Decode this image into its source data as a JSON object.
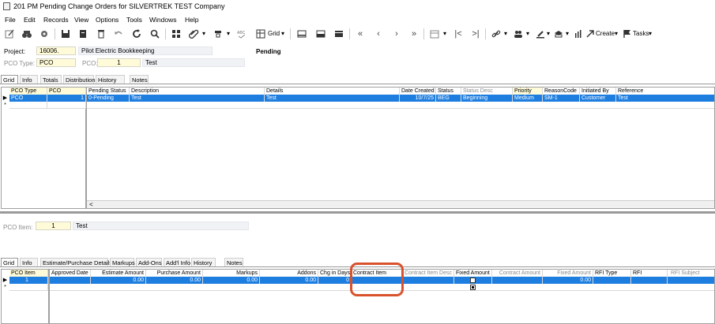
{
  "window": {
    "title": "201 PM Pending Change Orders for SILVERTREK TEST Company"
  },
  "menu": [
    "File",
    "Edit",
    "Records",
    "View",
    "Options",
    "Tools",
    "Windows",
    "Help"
  ],
  "toolbar": {
    "grid_label": "Grid",
    "create_label": "Create",
    "tasks_label": "Tasks",
    "icons": [
      "edit-icon",
      "binoculars-icon",
      "gear-icon",
      "save-icon",
      "new-doc-icon",
      "delete-icon",
      "undo-icon",
      "refresh-icon",
      "search-icon",
      "grid-icon",
      "attach-icon",
      "filter-icon",
      "spell-icon",
      "layout-icon",
      "first-icon",
      "prev-icon",
      "next-icon",
      "last-icon",
      "link-icon",
      "team-icon",
      "stamp-icon",
      "print-icon",
      "launch-icon",
      "flag-icon"
    ]
  },
  "header": {
    "project_label": "Project:",
    "project_value": "16006.",
    "project_desc": "Pilot Electric Bookkeeping",
    "status": "Pending",
    "pco_type_label": "PCO Type:",
    "pco_type_value": "PCO",
    "pco_label": "PCO:",
    "pco_value": "1",
    "pco_desc": "Test"
  },
  "top_tabs": [
    "Grid",
    "Info",
    "Totals",
    "Distribution",
    "History",
    "Notes"
  ],
  "top_grid": {
    "left_columns": [
      "PCO Type",
      "PCO"
    ],
    "left_row": [
      "PCO",
      "1"
    ],
    "columns": [
      "Pending Status",
      "Description",
      "Details",
      "Date Created",
      "Status",
      "Status Desc",
      "Priority",
      "ReasonCode",
      "Initiated By",
      "Reference"
    ],
    "row": [
      "0-Pending",
      "Test",
      "Test",
      "10/7/25",
      "BEG",
      "Beginning",
      "Medium",
      "SM-1",
      "Customer",
      "Test"
    ],
    "new_row_marker": "*",
    "scroll_left": "<"
  },
  "item_header": {
    "pco_item_label": "PCO Item:",
    "pco_item_value": "1",
    "pco_item_desc": "Test"
  },
  "bottom_tabs": [
    "Grid",
    "Info",
    "Estimate/Purchase Details",
    "Markups",
    "Add-Ons",
    "Add'l Info",
    "History",
    "Notes"
  ],
  "bottom_grid": {
    "left_columns": [
      "PCO Item"
    ],
    "left_row": [
      "1"
    ],
    "columns": [
      "Approved Date",
      "Estimate Amount",
      "Purchase Amount",
      "Markups",
      "Addons",
      "Chg in Days",
      "Contract Item",
      "Contract Item Desc",
      "Fixed Amount",
      "Contract Amount",
      "Fixed Amount",
      "RFI Type",
      "RFI",
      "RFI Subject"
    ],
    "row": [
      "",
      "0.00",
      "0.00",
      "0.00",
      "0.00",
      "0",
      "",
      "",
      "",
      "",
      "0.00",
      "",
      "",
      ""
    ],
    "new_row_marker": "*"
  },
  "colors": {
    "selection": "#1e7ee0",
    "highlight_field": "#fffbd9",
    "annotation_circle": "#d9522c"
  }
}
